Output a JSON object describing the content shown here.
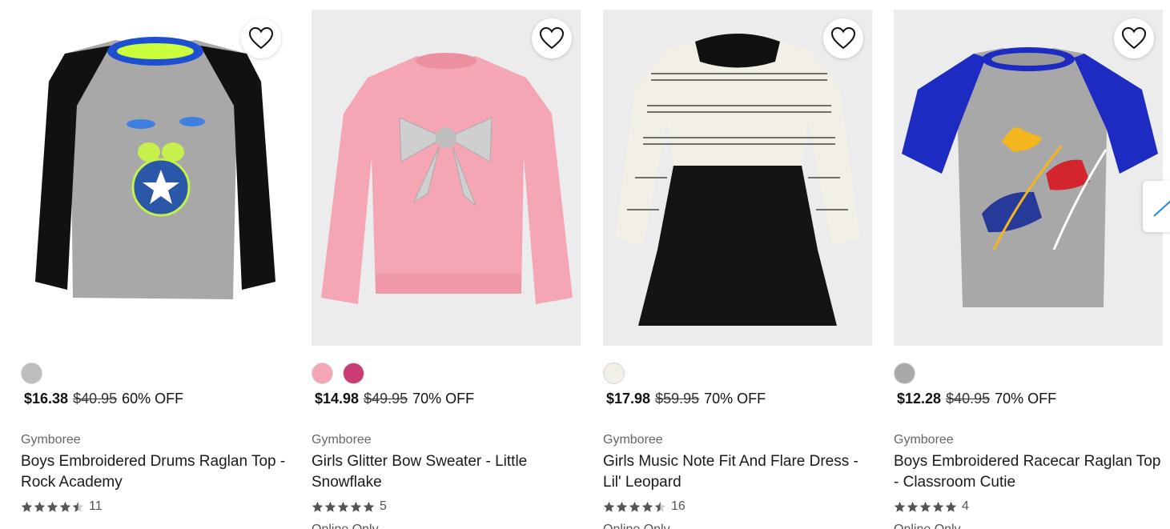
{
  "products": [
    {
      "swatches": [
        "#bdbdbd"
      ],
      "price_now": "$16.38",
      "price_old": "$40.95",
      "discount": "60% OFF",
      "brand": "Gymboree",
      "title": "Boys Embroidered Drums Raglan Top - Rock Academy",
      "rating": 4.5,
      "rating_count": "11",
      "availability": ""
    },
    {
      "swatches": [
        "#f4a6b4",
        "#c93b73"
      ],
      "price_now": "$14.98",
      "price_old": "$49.95",
      "discount": "70% OFF",
      "brand": "Gymboree",
      "title": "Girls Glitter Bow Sweater - Little Snowflake",
      "rating": 5,
      "rating_count": "5",
      "availability": "Online Only"
    },
    {
      "swatches": [
        "#f2efe6"
      ],
      "price_now": "$17.98",
      "price_old": "$59.95",
      "discount": "70% OFF",
      "brand": "Gymboree",
      "title": "Girls Music Note Fit And Flare Dress - Lil' Leopard",
      "rating": 4.5,
      "rating_count": "16",
      "availability": "Online Only"
    },
    {
      "swatches": [
        "#a9a9a9"
      ],
      "price_now": "$12.28",
      "price_old": "$40.95",
      "discount": "70% OFF",
      "brand": "Gymboree",
      "title": "Boys Embroidered Racecar Raglan Top - Classroom Cutie",
      "rating": 5,
      "rating_count": "4",
      "availability": "Online Only"
    }
  ],
  "icons": {
    "favorite": "heart-outline-icon",
    "star": "star-icon",
    "next": "arrow-right-icon"
  },
  "colors": {
    "star": "#555555",
    "star_empty": "#cfcfcf",
    "accent": "#1e88e5"
  }
}
